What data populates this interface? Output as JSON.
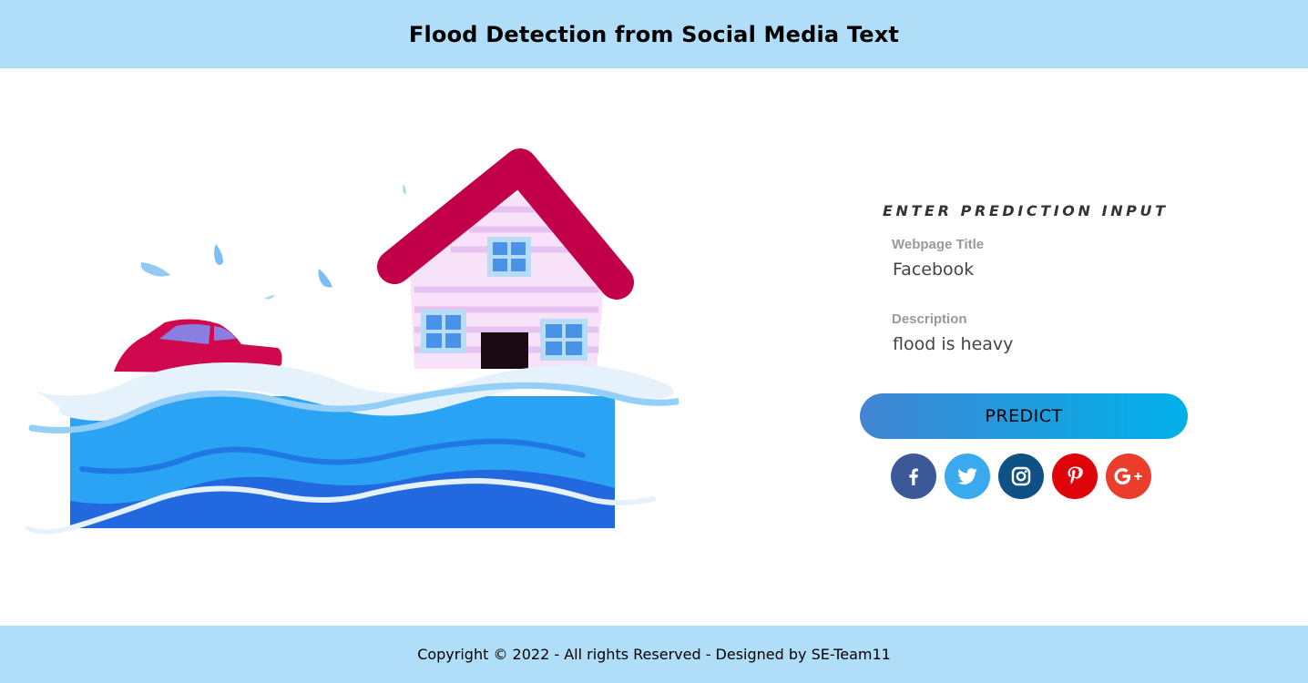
{
  "header": {
    "title": "Flood Detection from Social Media Text"
  },
  "illustration": {
    "icon": "flood-house-car-illustration"
  },
  "form": {
    "heading": "ENTER PREDICTION INPUT",
    "title_label": "Webpage Title",
    "title_value": "Facebook",
    "description_label": "Description",
    "description_value": "flood is heavy",
    "predict_label": "PREDICT"
  },
  "social": [
    {
      "name": "facebook-icon",
      "color": "#3b5998"
    },
    {
      "name": "twitter-icon",
      "color": "#3aaaf0"
    },
    {
      "name": "instagram-icon",
      "color": "#0e5185"
    },
    {
      "name": "pinterest-icon",
      "color": "#e0040a"
    },
    {
      "name": "google-plus-icon",
      "color": "#ea3d2b"
    }
  ],
  "footer": {
    "text": "Copyright © 2022 - All rights Reserved - Designed by SE-Team11"
  },
  "colors": {
    "bar_background": "#b0ddf7",
    "button_gradient_start": "#4285d3",
    "button_gradient_end": "#00b0ea"
  }
}
